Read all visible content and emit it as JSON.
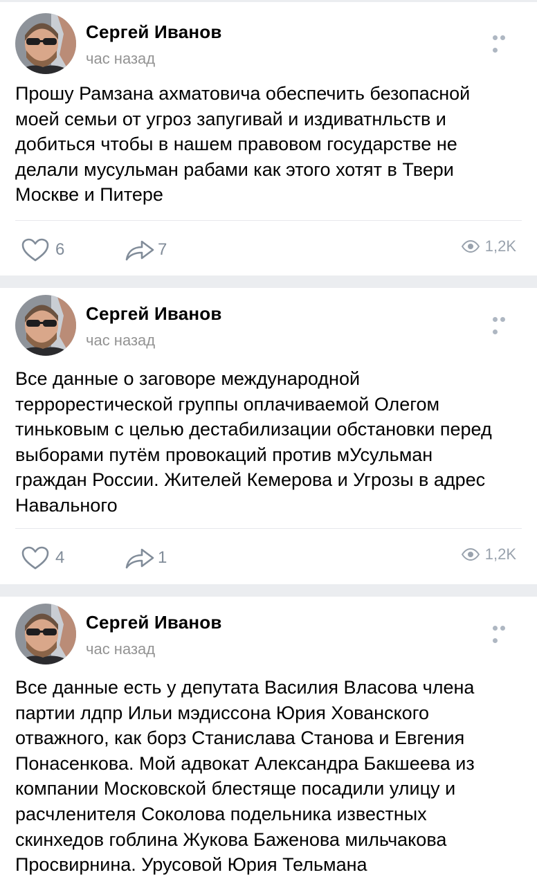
{
  "icons": {
    "more": "more-horizontal-icon",
    "like": "heart-outline-icon",
    "share": "share-arrow-icon",
    "views": "eye-icon"
  },
  "colors": {
    "separator": "#ebedf0",
    "time": "#939393",
    "action": "#818c99"
  },
  "posts": [
    {
      "author": "Сергей Иванов",
      "time": "час назад",
      "text": "Прошу Рамзана ахматовича обеспечить безопасной\nмоей семьи от угроз запугивай и издиватнльств и\nдобиться чтобы в нашем правовом государстве не\nделали мусульман рабами как этого хотят в Твери\nМоскве и Питере",
      "likes": "6",
      "shares": "7",
      "views": "1,2K"
    },
    {
      "author": "Сергей Иванов",
      "time": "час назад",
      "text": "Все данные о заговоре международной\nтеррорестической группы оплачиваемой Олегом\nтиньковым с целью дестабилизации обстановки перед\nвыборами путём провокаций против мУсульман\nграждан России. Жителей Кемерова и Угрозы в адрес\nНавального",
      "likes": "4",
      "shares": "1",
      "views": "1,2K"
    },
    {
      "author": "Сергей Иванов",
      "time": "час назад",
      "text": "Все данные есть у депутата Василия Власова члена\nпартии лдпр Ильи мэдиссона Юрия Хованского\nотважного, как борз Станислава Станова и Евгения\nПонасенкова. Мой адвокат Александра Бакшеева из\nкомпании Московской блестяще посадили улицу и\nрасчленителя Соколова подельника известных\nскинхедов гоблина Жукова Баженова мильчакова\nПросвирнина. Урусовой Юрия Тельмана"
    }
  ]
}
